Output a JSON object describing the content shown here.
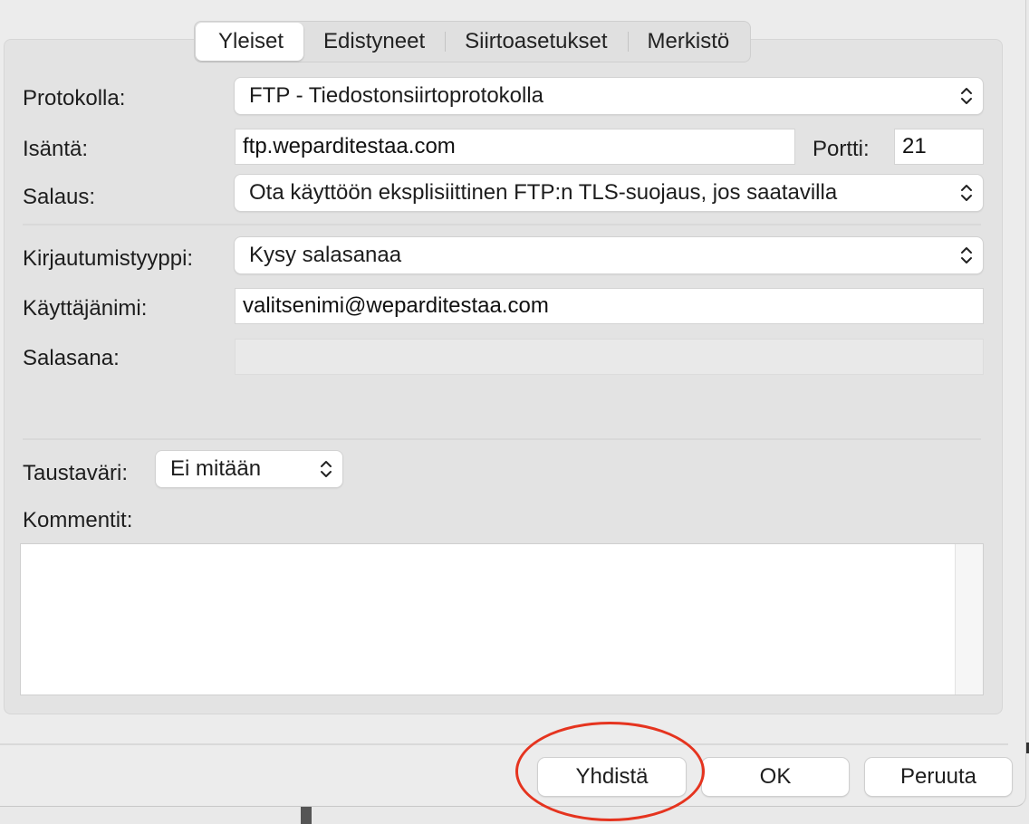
{
  "tabs": [
    {
      "label": "Yleiset",
      "active": true
    },
    {
      "label": "Edistyneet",
      "active": false
    },
    {
      "label": "Siirtoasetukset",
      "active": false
    },
    {
      "label": "Merkistö",
      "active": false
    }
  ],
  "form": {
    "protocol": {
      "label": "Protokolla:",
      "value": "FTP - Tiedostonsiirtoprotokolla"
    },
    "host": {
      "label": "Isäntä:",
      "value": "ftp.weparditestaa.com"
    },
    "port": {
      "label": "Portti:",
      "value": "21"
    },
    "encryption": {
      "label": "Salaus:",
      "value": "Ota käyttöön eksplisiittinen FTP:n TLS-suojaus, jos saatavilla"
    },
    "logon_type": {
      "label": "Kirjautumistyyppi:",
      "value": "Kysy salasanaa"
    },
    "username": {
      "label": "Käyttäjänimi:",
      "value": "valitsenimi@weparditestaa.com"
    },
    "password": {
      "label": "Salasana:",
      "value": ""
    },
    "background_color": {
      "label": "Taustaväri:",
      "value": "Ei mitään"
    },
    "comments": {
      "label": "Kommentit:",
      "value": ""
    }
  },
  "buttons": {
    "connect": "Yhdistä",
    "ok": "OK",
    "cancel": "Peruuta"
  },
  "colors": {
    "highlight_circle": "#e5341f",
    "window_bg": "#ececec",
    "panel_bg": "#e3e3e3"
  },
  "icons": {
    "select_indicator": "chevron-up-down-icon"
  }
}
